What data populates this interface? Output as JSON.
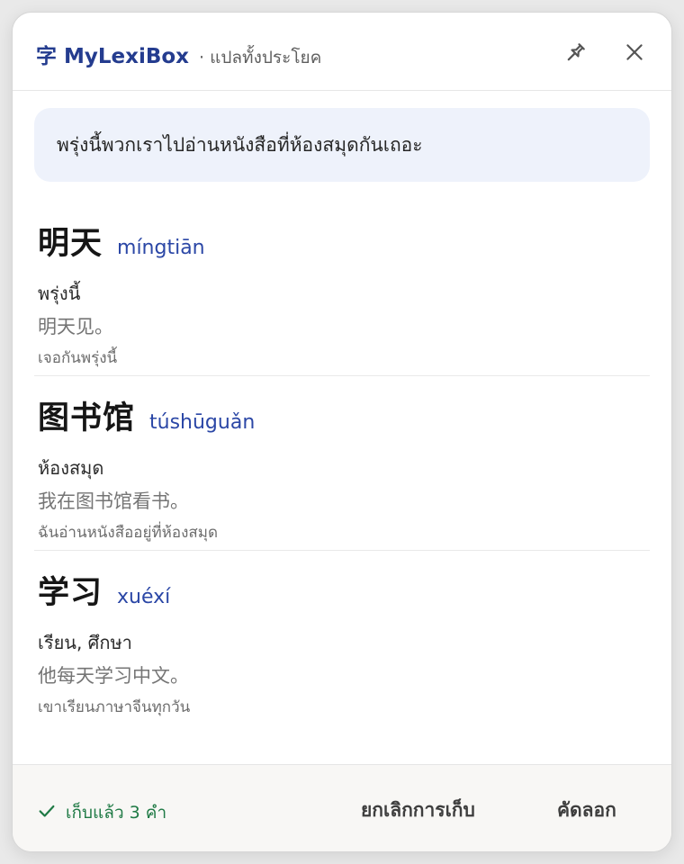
{
  "header": {
    "brand_char": "字",
    "brand_name": "MyLexiBox",
    "mode_label": "· แปลทั้งประโยค"
  },
  "sentence": "พรุ่งนี้พวกเราไปอ่านหนังสือที่ห้องสมุดกันเถอะ",
  "entries": [
    {
      "hanzi": "明天",
      "pinyin": "míngtiān",
      "meaning": "พรุ่งนี้",
      "example": "明天见。",
      "example_th": "เจอกันพรุ่งนี้"
    },
    {
      "hanzi": "图书馆",
      "pinyin": "túshūguǎn",
      "meaning": "ห้องสมุด",
      "example": "我在图书馆看书。",
      "example_th": "ฉันอ่านหนังสืออยู่ที่ห้องสมุด"
    },
    {
      "hanzi": "学习",
      "pinyin": "xuéxí",
      "meaning": "เรียน, ศึกษา",
      "example": "他每天学习中文。",
      "example_th": "เขาเรียนภาษาจีนทุกวัน"
    }
  ],
  "footer": {
    "saved_status": "เก็บแล้ว 3 คำ",
    "unsave_label": "ยกเลิกการเก็บ",
    "copy_label": "คัดลอก"
  },
  "icons": {
    "pin": "pin-icon",
    "close": "close-icon",
    "check": "check-icon"
  },
  "colors": {
    "brand": "#243c8f",
    "pinyin": "#2b47a6",
    "saved": "#1f7a45",
    "sentence_bg": "#eef2fb"
  }
}
